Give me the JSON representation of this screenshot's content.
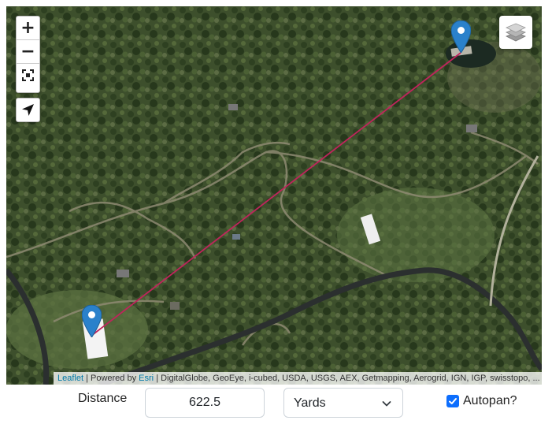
{
  "map": {
    "zoom_in_label": "+",
    "zoom_out_label": "−",
    "attribution": {
      "leaflet_link": "Leaflet",
      "powered_by": "| Powered by",
      "esri_link": "Esri",
      "sources": "| DigitalGlobe, GeoEye, i-cubed, USDA, USGS, AEX, Getmapping, Aerogrid, IGN, IGP, swisstopo, ..."
    },
    "marker_color": "#2a81cb",
    "line_color": "#c0245c",
    "icons": [
      "zoom-in-icon",
      "zoom-out-icon",
      "fit-bounds-icon",
      "locate-arrow-icon",
      "layers-icon",
      "map-marker-icon"
    ]
  },
  "form": {
    "distance_label": "Distance",
    "distance_value": "622.5",
    "unit_selected": "Yards",
    "autopan_label": "Autopan?",
    "autopan_checked": true
  }
}
